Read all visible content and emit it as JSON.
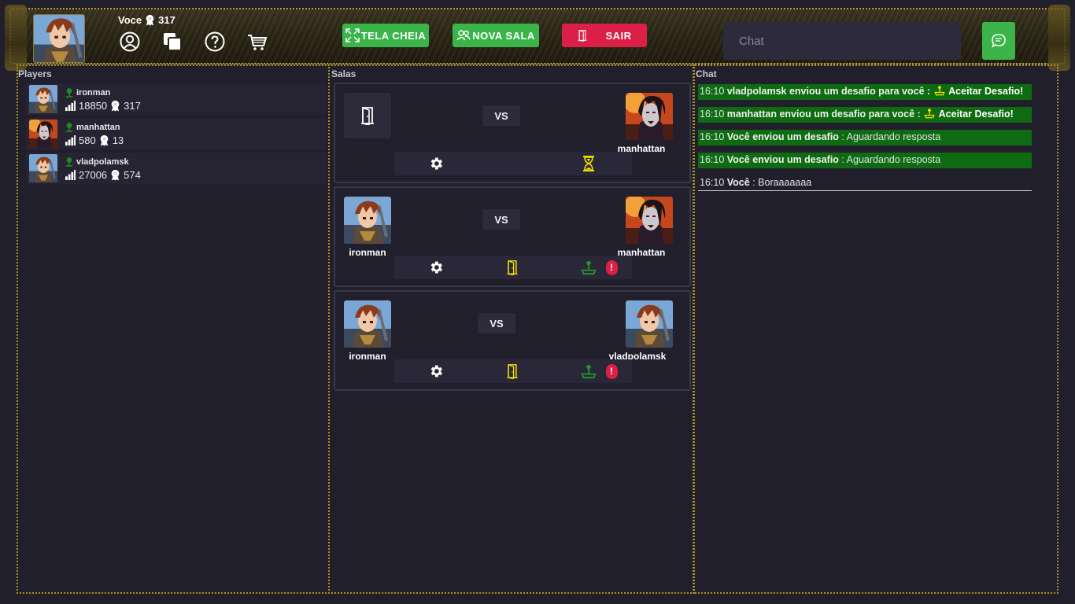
{
  "header": {
    "user_name": "Voce",
    "user_points": "317",
    "icons": [
      "user-circle-icon",
      "copy-icon",
      "help-icon",
      "cart-icon"
    ],
    "fullscreen_label": "TELA CHEIA",
    "new_room_label": "NOVA SALA",
    "exit_label": "SAIR",
    "chat_placeholder": "Chat"
  },
  "panels": {
    "players_title": "Players",
    "rooms_title": "Salas",
    "chat_title": "Chat"
  },
  "players": [
    {
      "name": "ironman",
      "score": "18850",
      "points": "317"
    },
    {
      "name": "manhattan",
      "score": "580",
      "points": "13"
    },
    {
      "name": "vladpolamsk",
      "score": "27006",
      "points": "574"
    }
  ],
  "rooms": [
    {
      "left": "",
      "right": "manhattan",
      "vs": "VS"
    },
    {
      "left": "ironman",
      "right": "manhattan",
      "vs": "VS",
      "alert": "!"
    },
    {
      "left": "ironman",
      "right": "vladpolamsk",
      "vs": "VS",
      "alert": "!"
    }
  ],
  "chat": [
    {
      "time": "16:10",
      "text": "vladpolamsk enviou um desafio para você :",
      "action": "Aceitar Desafio!"
    },
    {
      "time": "16:10",
      "text": "manhattan enviou um desafio para você :",
      "action": "Aceitar Desafio!"
    },
    {
      "time": "16:10",
      "text": "Você enviou um desafio",
      "rest": ": Aguardando resposta"
    },
    {
      "time": "16:10",
      "text": "Você enviou um desafio",
      "rest": ": Aguardando resposta"
    },
    {
      "time": "16:10",
      "text": "Você",
      "rest": ": Boraaaaaaa"
    }
  ],
  "colors": {
    "accent_green": "#3bb54a",
    "accent_red": "#dc1f46",
    "chat_highlight": "#0f6b12",
    "background": "#211f2c",
    "status_online": "#1e8a2a",
    "waiting_yellow": "#f2e000"
  }
}
